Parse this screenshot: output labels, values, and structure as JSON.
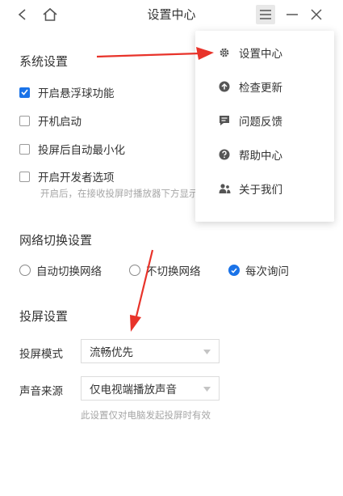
{
  "window": {
    "title": "设置中心"
  },
  "system_settings": {
    "title": "系统设置",
    "options": [
      {
        "label": "开启悬浮球功能",
        "checked": true
      },
      {
        "label": "开机启动",
        "checked": false
      },
      {
        "label": "投屏后自动最小化",
        "checked": false
      },
      {
        "label": "开启开发者选项",
        "checked": false
      }
    ],
    "dev_hint": "开启后，在接收投屏时播放器下方显示"
  },
  "network": {
    "title": "网络切换设置",
    "options": [
      {
        "label": "自动切换网络",
        "selected": false
      },
      {
        "label": "不切换网络",
        "selected": false
      },
      {
        "label": "每次询问",
        "selected": true
      }
    ]
  },
  "cast": {
    "title": "投屏设置",
    "mode_label": "投屏模式",
    "mode_value": "流畅优先",
    "audio_label": "声音来源",
    "audio_value": "仅电视端播放声音",
    "audio_hint": "此设置仅对电脑发起投屏时有效"
  },
  "menu": {
    "items": [
      {
        "label": "设置中心",
        "icon": "gear-icon"
      },
      {
        "label": "检查更新",
        "icon": "upload-icon"
      },
      {
        "label": "问题反馈",
        "icon": "feedback-icon"
      },
      {
        "label": "帮助中心",
        "icon": "help-icon"
      },
      {
        "label": "关于我们",
        "icon": "users-icon"
      }
    ]
  },
  "colors": {
    "accent": "#1a73e8",
    "annotation_arrow": "#e8332a"
  }
}
